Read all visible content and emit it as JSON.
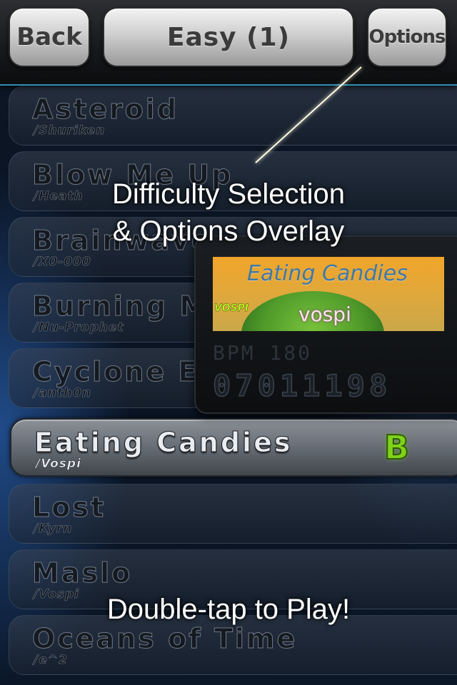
{
  "header": {
    "back_label": "Back",
    "title": "Easy (1)",
    "options_label": "Options"
  },
  "songs": [
    {
      "title": "Asteroid",
      "artist": "/Shuriken"
    },
    {
      "title": "Blow Me Up",
      "artist": "/Heath"
    },
    {
      "title": "Brainwave",
      "artist": "/X0-000"
    },
    {
      "title": "Burning M",
      "artist": "/Nu-Prophet"
    },
    {
      "title": "Cyclone E",
      "artist": "/anth0n"
    },
    {
      "title": "Eating Candies",
      "artist": "/Vospi",
      "grade": "B",
      "selected": true
    },
    {
      "title": "Lost",
      "artist": "/Kyrn"
    },
    {
      "title": "Maslo",
      "artist": "/Vospi"
    },
    {
      "title": "Oceans of Time",
      "artist": "/e^2"
    }
  ],
  "info_panel": {
    "jacket_title": "Eating Candies",
    "jacket_artist": "vospi",
    "jacket_logo": "VOSPI",
    "bpm": "BPM 180",
    "score": "07011198"
  },
  "overlay": {
    "top_line1": "Difficulty Selection",
    "top_line2": "& Options Overlay",
    "bottom": "Double-tap to Play!"
  },
  "colors": {
    "accent": "#2f8fb3",
    "grade": "#7fd21a",
    "background": "#0b1422"
  }
}
